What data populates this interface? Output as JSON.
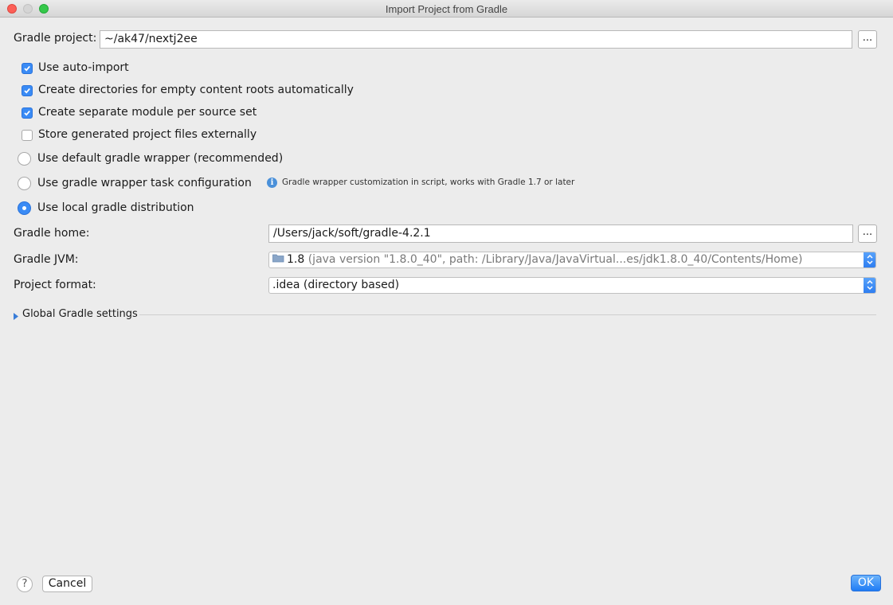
{
  "window": {
    "title": "Import Project from Gradle"
  },
  "project": {
    "label": "Gradle project:",
    "value": "~/ak47/nextj2ee",
    "browse": "..."
  },
  "options": {
    "auto_import": {
      "label": "Use auto-import",
      "checked": true
    },
    "create_dirs": {
      "label": "Create directories for empty content roots automatically",
      "checked": true
    },
    "separate_module": {
      "label": "Create separate module per source set",
      "checked": true
    },
    "store_external": {
      "label": "Store generated project files externally",
      "checked": false
    }
  },
  "distribution": {
    "default_wrapper": {
      "label": "Use default gradle wrapper (recommended)",
      "selected": false
    },
    "wrapper_task": {
      "label": "Use gradle wrapper task configuration",
      "selected": false,
      "hint": "Gradle wrapper customization in script, works with Gradle 1.7 or later"
    },
    "local": {
      "label": "Use local gradle distribution",
      "selected": true
    }
  },
  "gradle_home": {
    "label": "Gradle home:",
    "value": "/Users/jack/soft/gradle-4.2.1",
    "browse": "..."
  },
  "gradle_jvm": {
    "label": "Gradle JVM:",
    "version": "1.8",
    "detail": "(java version \"1.8.0_40\", path: /Library/Java/JavaVirtual...es/jdk1.8.0_40/Contents/Home)"
  },
  "project_format": {
    "label": "Project format:",
    "value": ".idea (directory based)"
  },
  "global_settings": {
    "label": "Global Gradle settings"
  },
  "footer": {
    "help": "?",
    "cancel": "Cancel",
    "ok": "OK"
  },
  "colors": {
    "accent": "#3a8bf5",
    "background": "#ececec"
  }
}
